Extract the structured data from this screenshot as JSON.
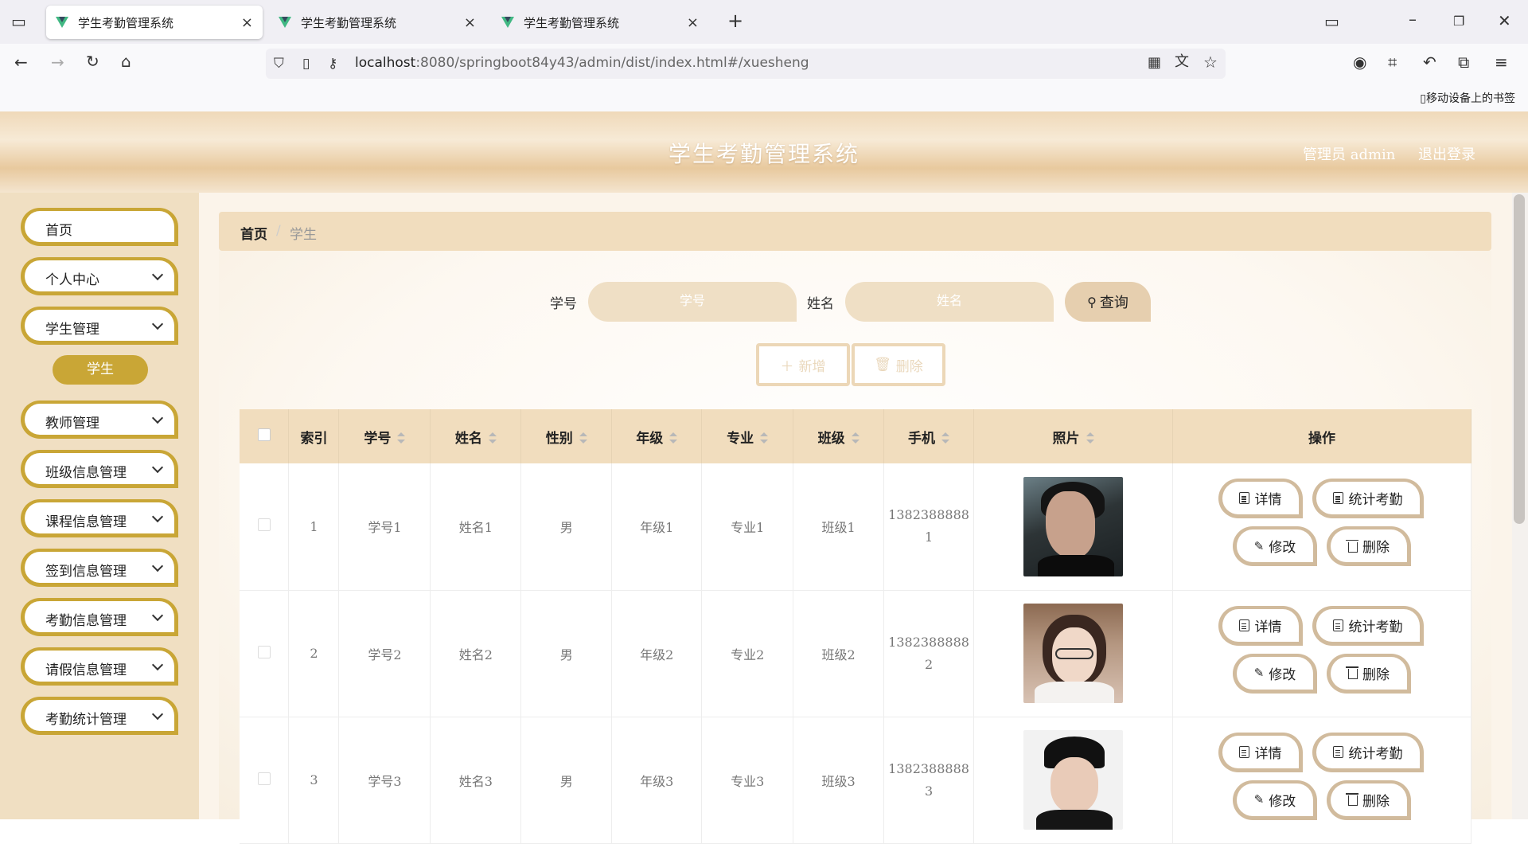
{
  "browser": {
    "tabs": [
      {
        "title": "学生考勤管理系统",
        "close": "×"
      },
      {
        "title": "学生考勤管理系统",
        "close": "×"
      },
      {
        "title": "学生考勤管理系统",
        "close": "×"
      }
    ],
    "new_tab": "+",
    "url_host": "localhost",
    "url_rest": ":8080/springboot84y43/admin/dist/index.html#/xuesheng",
    "bookmark_label": "移动设备上的书签"
  },
  "header": {
    "title": "学生考勤管理系统",
    "user": "管理员 admin",
    "logout": "退出登录"
  },
  "sidebar": {
    "items": [
      {
        "label": "首页",
        "chevron": false
      },
      {
        "label": "个人中心",
        "chevron": true
      },
      {
        "label": "学生管理",
        "chevron": true
      },
      {
        "label": "教师管理",
        "chevron": true
      },
      {
        "label": "班级信息管理",
        "chevron": true
      },
      {
        "label": "课程信息管理",
        "chevron": true
      },
      {
        "label": "签到信息管理",
        "chevron": true
      },
      {
        "label": "考勤信息管理",
        "chevron": true
      },
      {
        "label": "请假信息管理",
        "chevron": true
      },
      {
        "label": "考勤统计管理",
        "chevron": true
      }
    ],
    "active_sub": "学生"
  },
  "breadcrumb": {
    "home": "首页",
    "separator": "/",
    "current": "学生"
  },
  "search": {
    "id_label": "学号",
    "id_placeholder": "学号",
    "name_label": "姓名",
    "name_placeholder": "姓名",
    "query_button": "查询"
  },
  "actions": {
    "add": "新增",
    "delete": "删除"
  },
  "table": {
    "headers": [
      "索引",
      "学号",
      "姓名",
      "性别",
      "年级",
      "专业",
      "班级",
      "手机",
      "照片",
      "操作"
    ],
    "rows": [
      {
        "index": "1",
        "id": "学号1",
        "name": "姓名1",
        "gender": "男",
        "grade": "年级1",
        "major": "专业1",
        "class": "班级1",
        "phone_a": "1382388888",
        "phone_b": "1"
      },
      {
        "index": "2",
        "id": "学号2",
        "name": "姓名2",
        "gender": "男",
        "grade": "年级2",
        "major": "专业2",
        "class": "班级2",
        "phone_a": "1382388888",
        "phone_b": "2"
      },
      {
        "index": "3",
        "id": "学号3",
        "name": "姓名3",
        "gender": "男",
        "grade": "年级3",
        "major": "专业3",
        "class": "班级3",
        "phone_a": "1382388888",
        "phone_b": "3"
      }
    ],
    "ops": {
      "detail": "详情",
      "stat": "统计考勤",
      "edit": "修改",
      "delete": "删除"
    }
  },
  "colors": {
    "accent": "#c9a636",
    "header_band": "#f1ddbe",
    "sidebar_bg": "#f0dfc2"
  }
}
